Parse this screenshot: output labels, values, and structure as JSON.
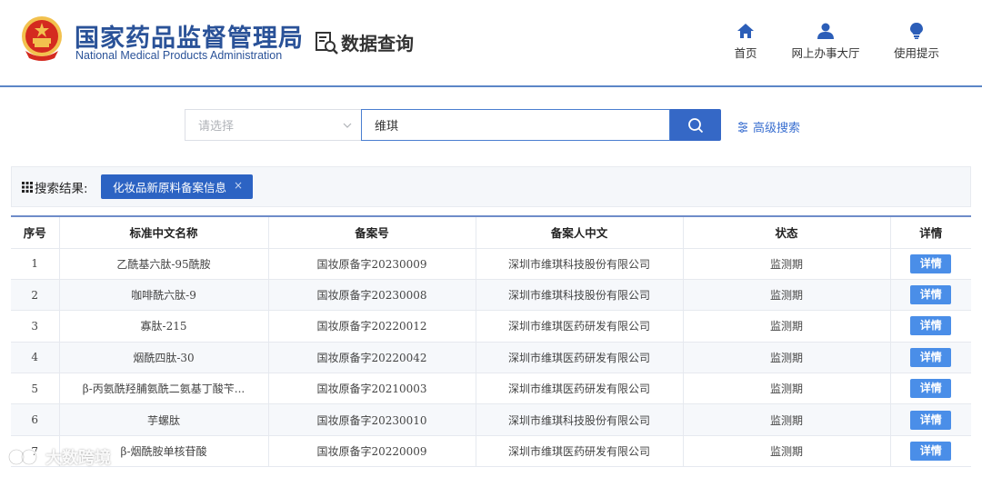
{
  "header": {
    "org_name_cn": "国家药品监督管理局",
    "org_name_en": "National Medical Products Administration",
    "section_title": "数据查询",
    "nav": [
      {
        "label": "首页",
        "icon": "home-icon"
      },
      {
        "label": "网上办事大厅",
        "icon": "user-icon"
      },
      {
        "label": "使用提示",
        "icon": "lightbulb-icon"
      }
    ]
  },
  "search": {
    "select_placeholder": "请选择",
    "query": "维琪",
    "button_icon": "search-icon",
    "advanced_label": "高级搜索"
  },
  "results": {
    "label": "搜索结果:",
    "tag": "化妆品新原料备案信息",
    "tag_close": "×"
  },
  "table": {
    "columns": [
      "序号",
      "标准中文名称",
      "备案号",
      "备案人中文",
      "状态",
      "详情"
    ],
    "detail_label": "详情",
    "rows": [
      {
        "no": "1",
        "name": "乙酰基六肽-95酰胺",
        "record": "国妆原备字20230009",
        "applicant": "深圳市维琪科技股份有限公司",
        "status": "监测期"
      },
      {
        "no": "2",
        "name": "咖啡酰六肽-9",
        "record": "国妆原备字20230008",
        "applicant": "深圳市维琪科技股份有限公司",
        "status": "监测期"
      },
      {
        "no": "3",
        "name": "寡肽-215",
        "record": "国妆原备字20220012",
        "applicant": "深圳市维琪医药研发有限公司",
        "status": "监测期"
      },
      {
        "no": "4",
        "name": "烟酰四肽-30",
        "record": "国妆原备字20220042",
        "applicant": "深圳市维琪医药研发有限公司",
        "status": "监测期"
      },
      {
        "no": "5",
        "name": "β-丙氨酰羟脯氨酰二氨基丁酸苄...",
        "record": "国妆原备字20210003",
        "applicant": "深圳市维琪医药研发有限公司",
        "status": "监测期"
      },
      {
        "no": "6",
        "name": "芋螺肽",
        "record": "国妆原备字20230010",
        "applicant": "深圳市维琪科技股份有限公司",
        "status": "监测期"
      },
      {
        "no": "7",
        "name": "β-烟酰胺单核苷酸",
        "record": "国妆原备字20220009",
        "applicant": "深圳市维琪医药研发有限公司",
        "status": "监测期"
      }
    ]
  },
  "watermark": {
    "text": "大数跨境"
  },
  "colors": {
    "brand_blue": "#2a5298",
    "button_blue": "#3568c6",
    "detail_blue": "#4a8ee8",
    "emblem_red": "#d42a1f",
    "emblem_gold": "#f2c14e"
  }
}
